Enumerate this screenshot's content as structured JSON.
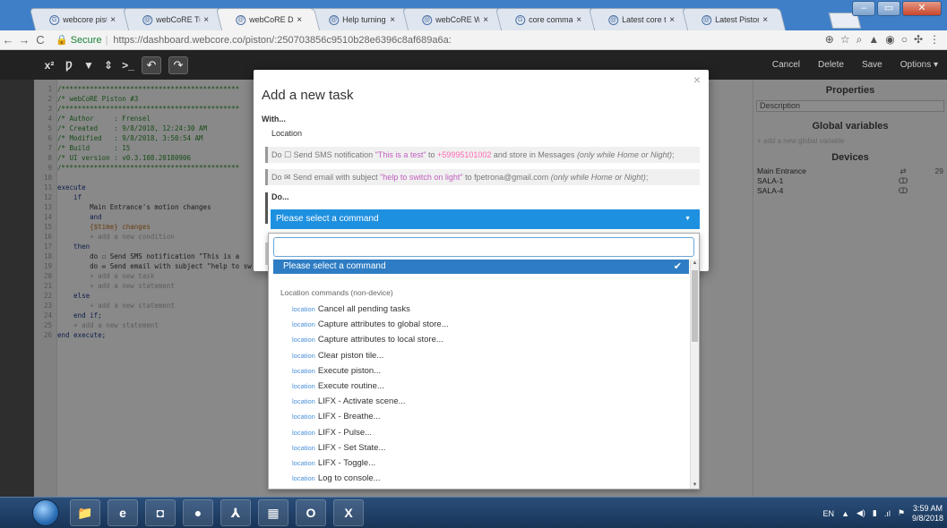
{
  "browser": {
    "tabs": [
      {
        "title": "webcore piston temp",
        "icon": "G",
        "active": false
      },
      {
        "title": "webCoRE Tutorial Hub",
        "icon": "@",
        "active": false
      },
      {
        "title": "webCoRE Dashboard",
        "icon": "@",
        "active": true
      },
      {
        "title": "Help turning lights on",
        "icon": "@",
        "active": false
      },
      {
        "title": "webCoRE Wiki - Web",
        "icon": "@",
        "active": false
      },
      {
        "title": "core commands",
        "icon": "G",
        "active": false
      },
      {
        "title": "Latest core topics",
        "icon": "@",
        "active": false
      },
      {
        "title": "Latest Piston: Design",
        "icon": "@",
        "active": false
      }
    ],
    "tab_close": "×",
    "secure_label": "Secure",
    "url": "https://dashboard.webcore.co/piston/:250703856c9510b28e6396c8af689a6a:"
  },
  "toolbar": {
    "buttons": [
      "x²",
      "Ƿ",
      "▼",
      "⇕",
      ">_",
      "↶",
      "↷"
    ],
    "actions": [
      "Cancel",
      "Delete",
      "Save",
      "Options ▾"
    ]
  },
  "editor": {
    "line_numbers": [
      "1",
      "2",
      "3",
      "4",
      "5",
      "6",
      "7",
      "8",
      "9",
      "10",
      "11",
      "12",
      "13",
      "14",
      "15",
      "16",
      "17",
      "18",
      "19",
      "20",
      "21",
      "22",
      "23",
      "24",
      "25",
      "26"
    ],
    "lines": [
      "/********************************************",
      "/* webCoRE Piston #3",
      "/********************************************",
      "/* Author     : Frensel",
      "/* Created    : 9/8/2018, 12:24:30 AM",
      "/* Modified   : 9/8/2018, 3:50:54 AM",
      "/* Build      : 15",
      "/* UI version : v0.3.108.20180906",
      "/********************************************",
      "",
      "execute",
      "    if",
      "        Main Entrance's motion changes",
      "        and",
      "        {$time} changes",
      "        + add a new condition",
      "    then",
      "        do ☐ Send SMS notification \"This is a",
      "        do ✉ Send email with subject \"help to sw",
      "        + add a new task",
      "        + add a new statement",
      "    else",
      "        + add a new statement",
      "    end if;",
      "    + add a new statement",
      "end execute;"
    ]
  },
  "panel": {
    "properties_title": "Properties",
    "description_label": "Description",
    "globals_title": "Global variables",
    "globals_hint": "+ add a new global variable",
    "devices_title": "Devices",
    "devices": [
      {
        "name": "Main Entrance",
        "icon": "⇄",
        "value": "29"
      },
      {
        "name": "SALA-1",
        "icon": "ↀ",
        "value": ""
      },
      {
        "name": "SALA-4",
        "icon": "ↀ",
        "value": ""
      }
    ]
  },
  "modal": {
    "title": "Add a new task",
    "close": "×",
    "with_label": "With...",
    "with_value": "Location",
    "context_tasks": [
      {
        "prefix": "Do ☐ Send SMS notification ",
        "quote": "\"This is a test\"",
        "mid": " to ",
        "target": "+59995101002",
        "suffix": " and store in Messages ",
        "condition": "(only while Home or Night)",
        "end": ";"
      },
      {
        "prefix": "Do ✉ Send email with subject ",
        "quote": "\"help to switch on light\"",
        "mid": " to ",
        "target": "fpetrona@gmail.com",
        "suffix": " ",
        "condition": "(only while Home or Night)",
        "end": ";"
      }
    ],
    "do_label": "Do...",
    "command_select": "Please select a command"
  },
  "dropdown": {
    "selected": "Please select a command",
    "group_label": "Location commands (non-device)",
    "tag": "location",
    "options": [
      "Cancel all pending tasks",
      "Capture attributes to global store...",
      "Capture attributes to local store...",
      "Clear piston tile...",
      "Execute piston...",
      "Execute routine...",
      "LIFX - Activate scene...",
      "LIFX - Breathe...",
      "LIFX - Pulse...",
      "LIFX - Set State...",
      "LIFX - Toggle...",
      "Log to console..."
    ]
  },
  "taskbar": {
    "apps": [
      "📁",
      "e",
      "◘",
      "●",
      "⅄",
      "▦",
      "O",
      "X"
    ],
    "language": "EN",
    "time": "3:59 AM",
    "date": "9/8/2018"
  }
}
